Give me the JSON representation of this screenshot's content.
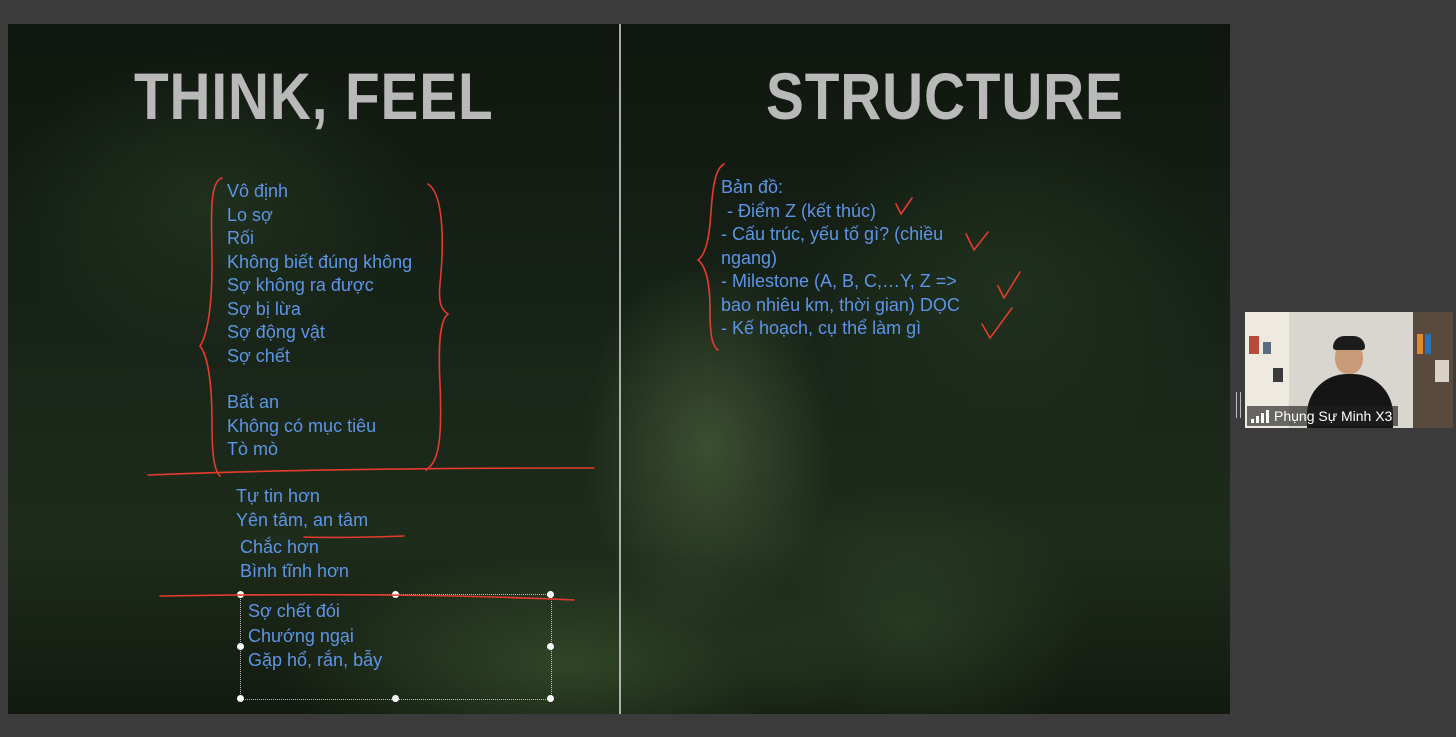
{
  "slide": {
    "left_title": "THINK, FEEL",
    "right_title": "STRUCTURE",
    "left_group_1": [
      "Vô định",
      "Lo sợ",
      "Rối",
      "Không biết đúng không",
      "Sợ không ra được",
      "Sợ bị lừa",
      "Sợ động vật",
      "Sợ chết"
    ],
    "left_group_2": [
      "Bất an",
      "Không có mục tiêu",
      "Tò mò"
    ],
    "left_group_3": [
      "Tự tin hơn",
      "Yên tâm, an tâm"
    ],
    "left_group_4": [
      "Chắc hơn",
      "Bình tĩnh hơn"
    ],
    "left_group_5": [
      "Sợ chết đói",
      "Chướng ngại",
      "Gặp hổ, rắn, bẫy"
    ],
    "right_lines": [
      "Bản đồ:",
      "  - Điểm Z (kết thúc)",
      "- Cấu trúc, yếu tố gì? (chiều",
      "ngang)",
      "- Milestone (A, B, C,…Y, Z =>",
      "bao nhiêu km, thời gian) DỌC",
      "- Kế hoạch, cụ thể làm gì"
    ]
  },
  "webcam": {
    "participant_name": "Phụng Sự Minh X3"
  },
  "colors": {
    "text_blue": "#5d95e6",
    "ink_red": "#e53b2e",
    "title_gray": "#b9b9b9",
    "app_background": "#3b3b3b"
  },
  "icons": {
    "signal": "signal-strength-icon"
  }
}
